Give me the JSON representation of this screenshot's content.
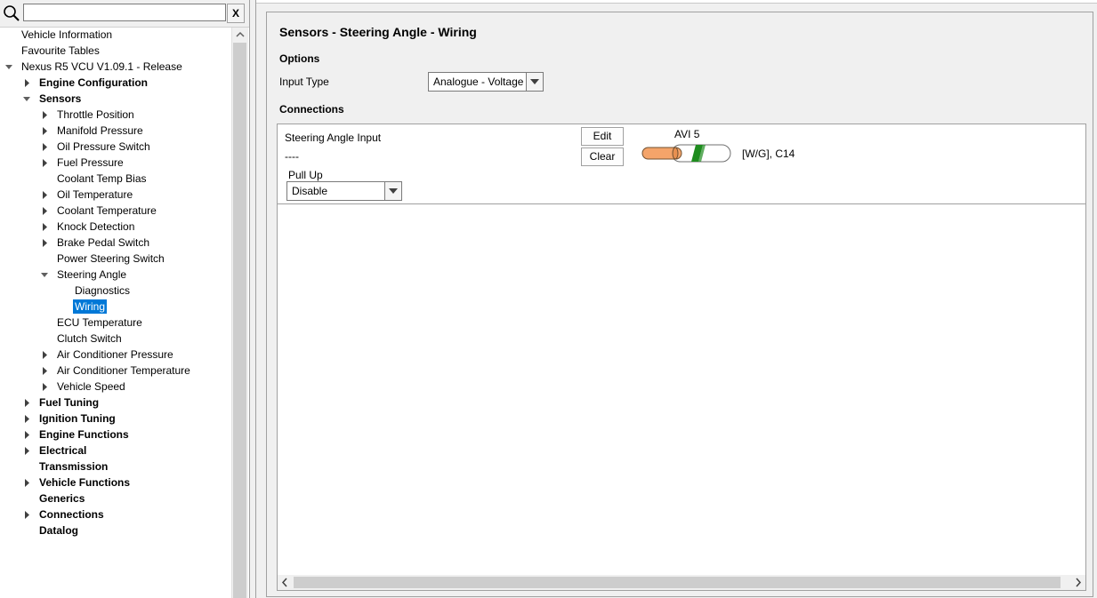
{
  "search": {
    "value": "",
    "clear_label": "X"
  },
  "tree": [
    {
      "label": "Vehicle Information",
      "level": 0,
      "arrow": "none",
      "bold": false
    },
    {
      "label": "Favourite Tables",
      "level": 0,
      "arrow": "none",
      "bold": false
    },
    {
      "label": "Nexus R5 VCU V1.09.1 - Release",
      "level": 0,
      "arrow": "open",
      "bold": false
    },
    {
      "label": "Engine Configuration",
      "level": 1,
      "arrow": "closed",
      "bold": true
    },
    {
      "label": "Sensors",
      "level": 1,
      "arrow": "open",
      "bold": true
    },
    {
      "label": "Throttle Position",
      "level": 2,
      "arrow": "closed",
      "bold": false
    },
    {
      "label": "Manifold Pressure",
      "level": 2,
      "arrow": "closed",
      "bold": false
    },
    {
      "label": "Oil Pressure Switch",
      "level": 2,
      "arrow": "closed",
      "bold": false
    },
    {
      "label": "Fuel Pressure",
      "level": 2,
      "arrow": "closed",
      "bold": false
    },
    {
      "label": "Coolant Temp Bias",
      "level": 2,
      "arrow": "none",
      "bold": false
    },
    {
      "label": "Oil Temperature",
      "level": 2,
      "arrow": "closed",
      "bold": false
    },
    {
      "label": "Coolant Temperature",
      "level": 2,
      "arrow": "closed",
      "bold": false
    },
    {
      "label": "Knock Detection",
      "level": 2,
      "arrow": "closed",
      "bold": false
    },
    {
      "label": "Brake Pedal Switch",
      "level": 2,
      "arrow": "closed",
      "bold": false
    },
    {
      "label": "Power Steering Switch",
      "level": 2,
      "arrow": "none",
      "bold": false
    },
    {
      "label": "Steering Angle",
      "level": 2,
      "arrow": "open",
      "bold": false
    },
    {
      "label": "Diagnostics",
      "level": 3,
      "arrow": "none",
      "bold": false
    },
    {
      "label": "Wiring",
      "level": 3,
      "arrow": "none",
      "bold": false,
      "selected": true
    },
    {
      "label": "ECU Temperature",
      "level": 2,
      "arrow": "none",
      "bold": false
    },
    {
      "label": "Clutch Switch",
      "level": 2,
      "arrow": "none",
      "bold": false
    },
    {
      "label": "Air Conditioner Pressure",
      "level": 2,
      "arrow": "closed",
      "bold": false
    },
    {
      "label": "Air Conditioner Temperature",
      "level": 2,
      "arrow": "closed",
      "bold": false
    },
    {
      "label": "Vehicle Speed",
      "level": 2,
      "arrow": "closed",
      "bold": false
    },
    {
      "label": "Fuel Tuning",
      "level": 1,
      "arrow": "closed",
      "bold": true
    },
    {
      "label": "Ignition Tuning",
      "level": 1,
      "arrow": "closed",
      "bold": true
    },
    {
      "label": "Engine Functions",
      "level": 1,
      "arrow": "closed",
      "bold": true
    },
    {
      "label": "Electrical",
      "level": 1,
      "arrow": "closed",
      "bold": true
    },
    {
      "label": "Transmission",
      "level": 1,
      "arrow": "none",
      "bold": true
    },
    {
      "label": "Vehicle Functions",
      "level": 1,
      "arrow": "closed",
      "bold": true
    },
    {
      "label": "Generics",
      "level": 1,
      "arrow": "none",
      "bold": true
    },
    {
      "label": "Connections",
      "level": 1,
      "arrow": "closed",
      "bold": true
    },
    {
      "label": "Datalog",
      "level": 1,
      "arrow": "none",
      "bold": true
    }
  ],
  "main": {
    "title": "Sensors - Steering Angle - Wiring",
    "options_heading": "Options",
    "input_type_label": "Input Type",
    "input_type_value": "Analogue - Voltage",
    "connections_heading": "Connections",
    "connection": {
      "name": "Steering Angle Input",
      "value": "----",
      "pullup_label": "Pull Up",
      "pullup_value": "Disable",
      "edit_label": "Edit",
      "clear_label": "Clear",
      "pin_label": "AVI 5",
      "wire_info": "[W/G], C14"
    }
  },
  "colors": {
    "selection": "#0078d7",
    "wire_copper": "#f4a46a",
    "wire_stripe": "#1e8c1e"
  },
  "icons": [
    "search-icon",
    "expand-arrow-icon",
    "collapse-arrow-icon",
    "dropdown-arrow-icon",
    "scroll-up-icon",
    "scroll-left-icon",
    "scroll-right-icon"
  ]
}
